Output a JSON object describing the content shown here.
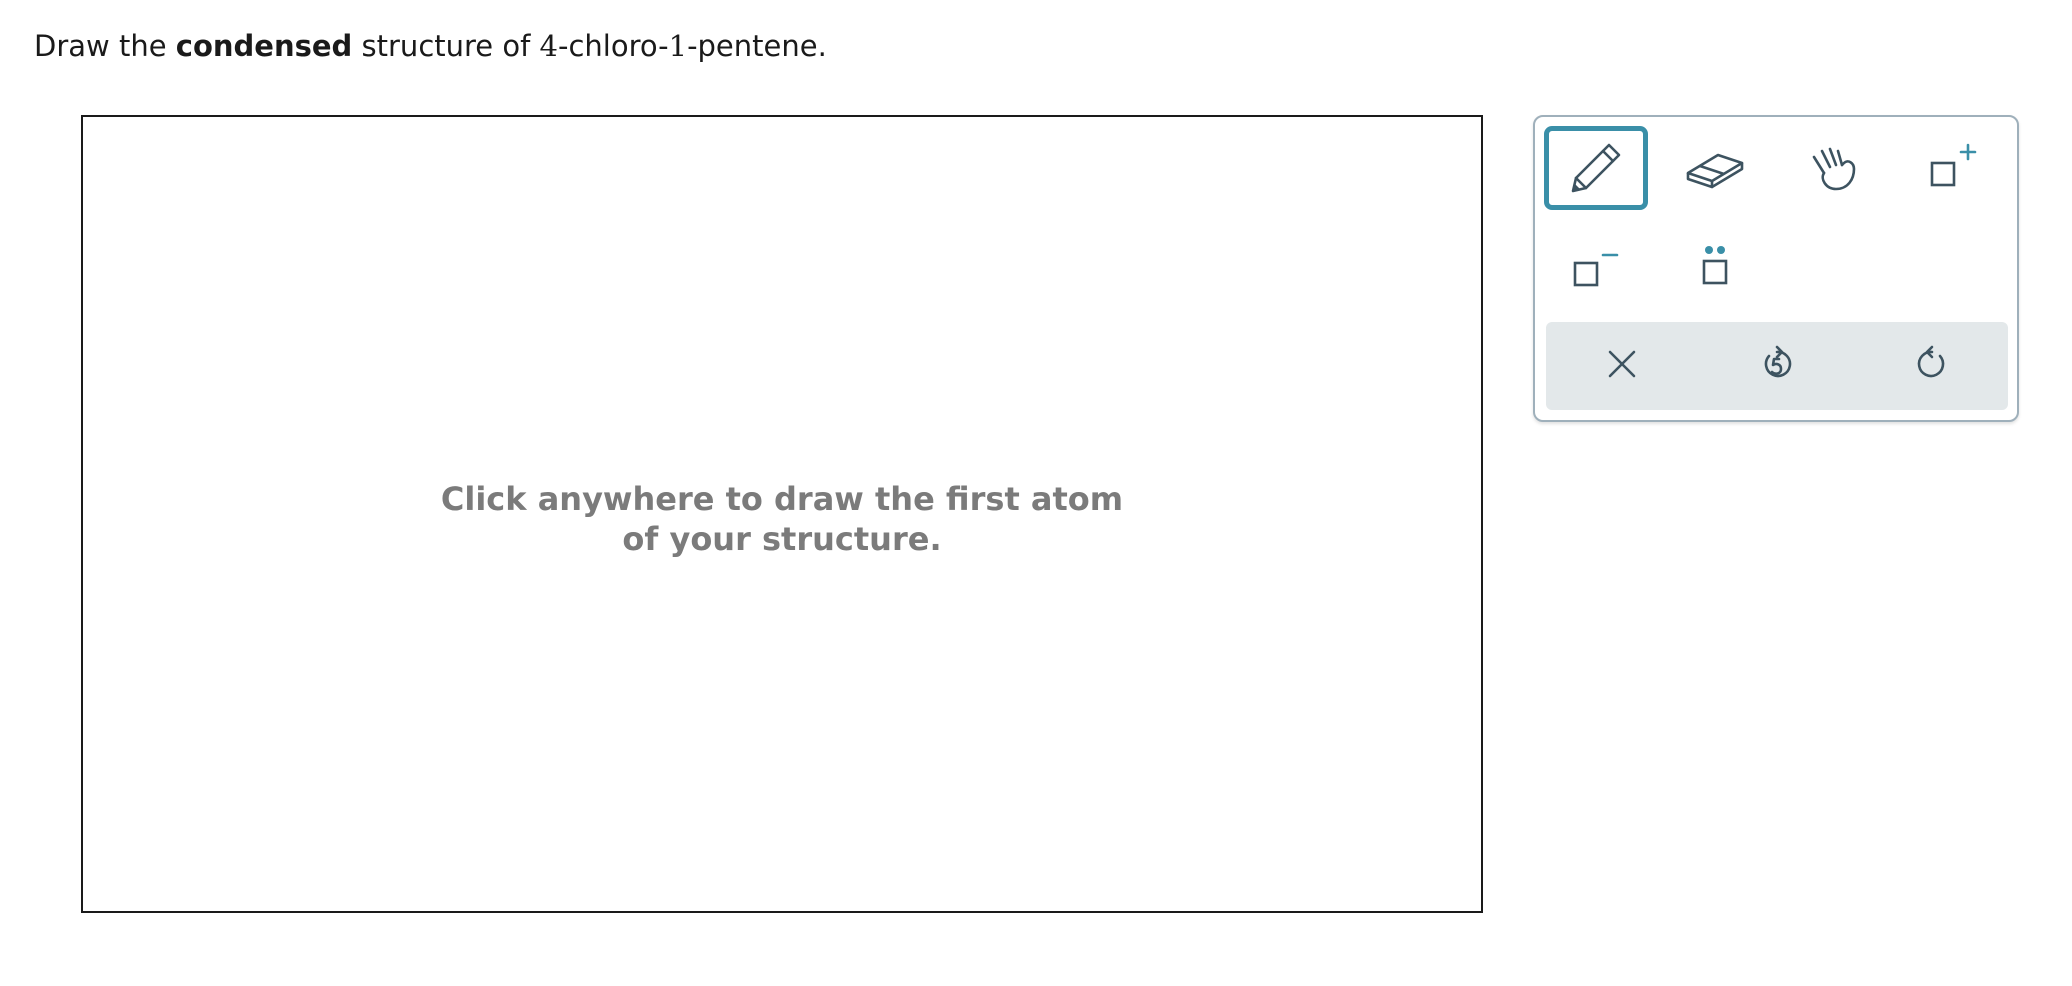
{
  "prompt": {
    "prefix": "Draw the ",
    "emphasis": "condensed",
    "middle": " structure of ",
    "compound_num1": "4",
    "compound_part1": "-chloro-",
    "compound_num2": "1",
    "compound_part2": "-pentene."
  },
  "canvas": {
    "hint_line1": "Click anywhere to draw the first atom",
    "hint_line2": "of your structure."
  },
  "toolbar": {
    "tools": [
      {
        "name": "pencil",
        "icon": "pencil-icon",
        "selected": true
      },
      {
        "name": "eraser",
        "icon": "eraser-icon",
        "selected": false
      },
      {
        "name": "hand",
        "icon": "hand-icon",
        "selected": false
      },
      {
        "name": "positive-charge",
        "icon": "positive-charge-icon",
        "selected": false
      },
      {
        "name": "negative-charge",
        "icon": "negative-charge-icon",
        "selected": false
      },
      {
        "name": "lone-pair",
        "icon": "lone-pair-icon",
        "selected": false
      }
    ],
    "actions": [
      {
        "name": "clear",
        "icon": "close-icon"
      },
      {
        "name": "undo",
        "icon": "undo-icon"
      },
      {
        "name": "redo",
        "icon": "redo-icon"
      }
    ],
    "colors": {
      "icon": "#3d5360",
      "accent": "#3a8fa8",
      "action_bar": "#e3e8ea"
    }
  }
}
